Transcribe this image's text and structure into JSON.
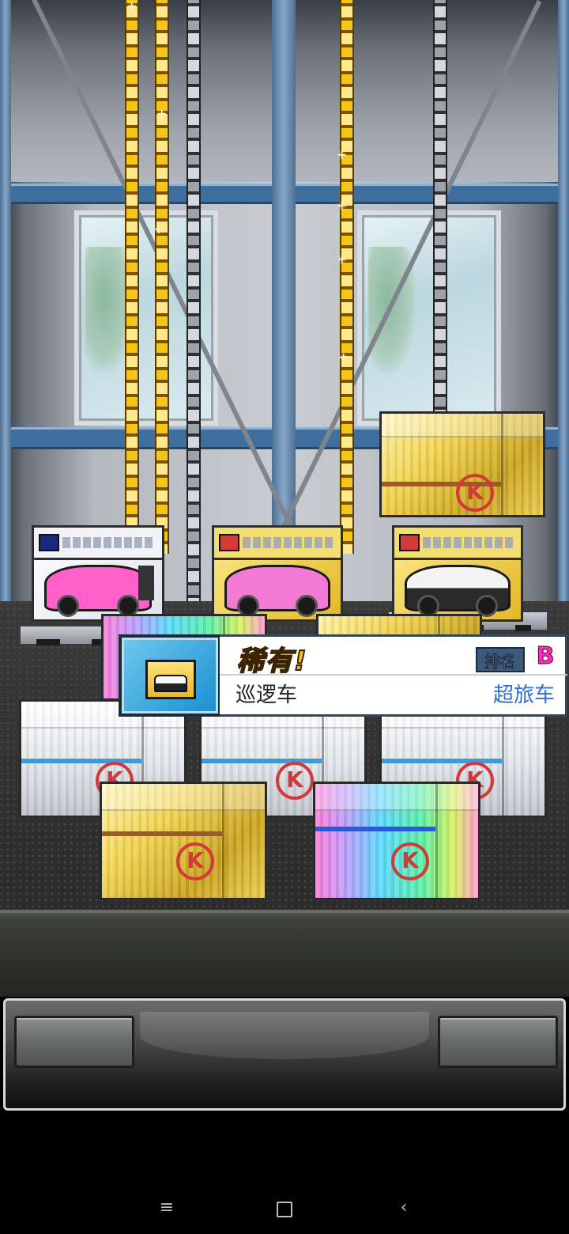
{
  "scene": {
    "name": "container-crane-gacha"
  },
  "colors": {
    "rarity_text": "#f4c21a",
    "rank_badge": "#ff2db4",
    "category_text": "#2c6fd6",
    "chain_gold": "#f5c51a",
    "chain_grey": "#9ea3aa"
  },
  "notification": {
    "rarity": "稀有!",
    "rank_label": "排名",
    "rank_value": "B",
    "item_name": "巡逻车",
    "item_category": "超旅车",
    "thumbnail_icon": "patrol-car-box-icon"
  },
  "prizes": [
    {
      "name": "pink-formula-car-box",
      "box_color": "#ecedf2",
      "car_color": "#ff5fc8"
    },
    {
      "name": "pink-buggy-car-box",
      "box_color": "#f2d24a",
      "car_color": "#f27ad2"
    },
    {
      "name": "patrol-car-box",
      "box_color": "#f2d24a",
      "car_color": "#d8d8d8"
    }
  ],
  "containers": [
    {
      "name": "gold-container",
      "tier": "gold"
    },
    {
      "name": "white-container",
      "tier": "white"
    },
    {
      "name": "white-container",
      "tier": "white"
    },
    {
      "name": "white-container",
      "tier": "white"
    },
    {
      "name": "gold-container",
      "tier": "gold"
    },
    {
      "name": "rainbow-container",
      "tier": "rainbow"
    }
  ],
  "controls": {
    "left_button_label": "",
    "right_button_label": ""
  },
  "navigation": {
    "menu_icon": "menu-icon",
    "home_icon": "home-icon",
    "back_icon": "back-icon",
    "menu_glyph": "≡",
    "back_glyph": "‹"
  }
}
